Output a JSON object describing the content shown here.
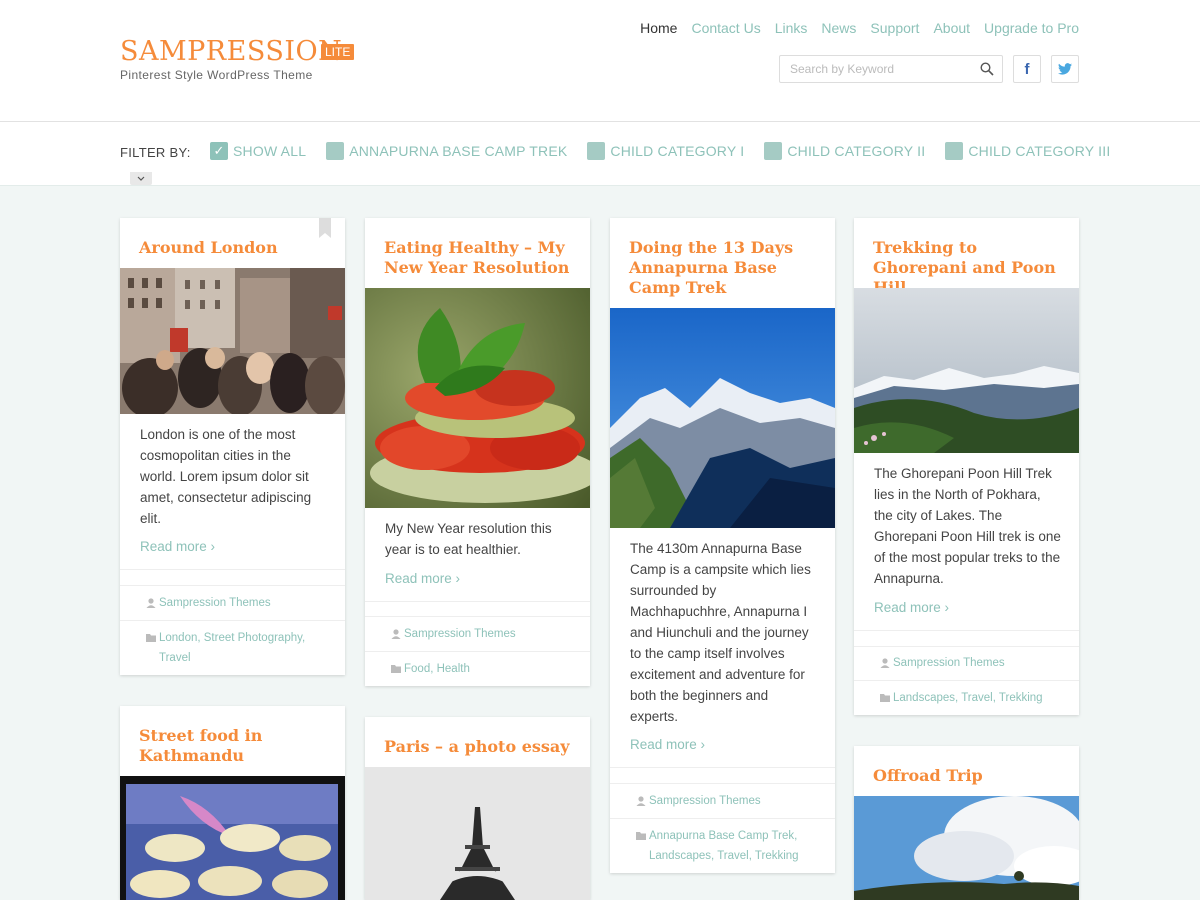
{
  "site": {
    "title": "SAMPRESSION",
    "badge": "LITE",
    "tagline": "Pinterest Style WordPress Theme"
  },
  "nav": {
    "items": [
      "Home",
      "Contact Us",
      "Links",
      "News",
      "Support",
      "About",
      "Upgrade to Pro"
    ],
    "active": "Home"
  },
  "search": {
    "placeholder": "Search by Keyword"
  },
  "social": {
    "facebook": "f",
    "twitter": "twitter-bird-icon"
  },
  "filter": {
    "label": "FILTER BY:",
    "items": [
      {
        "label": "SHOW ALL",
        "checked": true
      },
      {
        "label": "ANNAPURNA BASE CAMP TREK",
        "checked": false
      },
      {
        "label": "CHILD CATEGORY I",
        "checked": false
      },
      {
        "label": "CHILD CATEGORY II",
        "checked": false
      },
      {
        "label": "CHILD CATEGORY III",
        "checked": false
      }
    ]
  },
  "colors": {
    "accent": "#f58b3a",
    "teal": "#8ec2b9",
    "background": "#f1f6f5"
  },
  "posts": [
    {
      "title": "Around London",
      "excerpt": "London is one of the most cosmopolitan cities in the world. Lorem ipsum dolor sit amet, consectetur adipiscing elit.",
      "readmore": "Read more ›",
      "author": "Sampression Themes",
      "categories": "London, Street Photography, Travel",
      "image": "london-street-crowd"
    },
    {
      "title": "Eating Healthy – My New Year Resolution",
      "excerpt": "My New Year resolution this year is to eat healthier.",
      "readmore": "Read more ›",
      "author": "Sampression Themes",
      "categories": "Food, Health",
      "image": "tomato-basil-salad"
    },
    {
      "title": "Doing the 13 Days Annapurna Base Camp Trek",
      "excerpt": "The 4130m Annapurna Base Camp is a campsite which lies surrounded by Machhapuchhre, Annapurna I and Hiunchuli and the journey to the camp itself involves excitement and adventure for both the beginners and experts.",
      "readmore": "Read more ›",
      "author": "Sampression Themes",
      "categories": "Annapurna Base Camp Trek, Landscapes, Travel, Trekking",
      "image": "annapurna-mountains"
    },
    {
      "title": "Trekking to Ghorepani and Poon Hill",
      "excerpt": "The Ghorepani Poon Hill Trek lies in the North of Pokhara, the city of Lakes. The Ghorepani Poon Hill trek is one of the most popular treks to the Annapurna.",
      "readmore": "Read more ›",
      "author": "Sampression Themes",
      "categories": "Landscapes, Travel, Trekking",
      "image": "ghorepani-hills"
    },
    {
      "title": "Street food in Kathmandu",
      "image": "street-food-griddle"
    },
    {
      "title": "Paris – a photo essay",
      "image": "eiffel-tower"
    },
    {
      "title": "Offroad Trip",
      "image": "offroad-sky"
    }
  ]
}
